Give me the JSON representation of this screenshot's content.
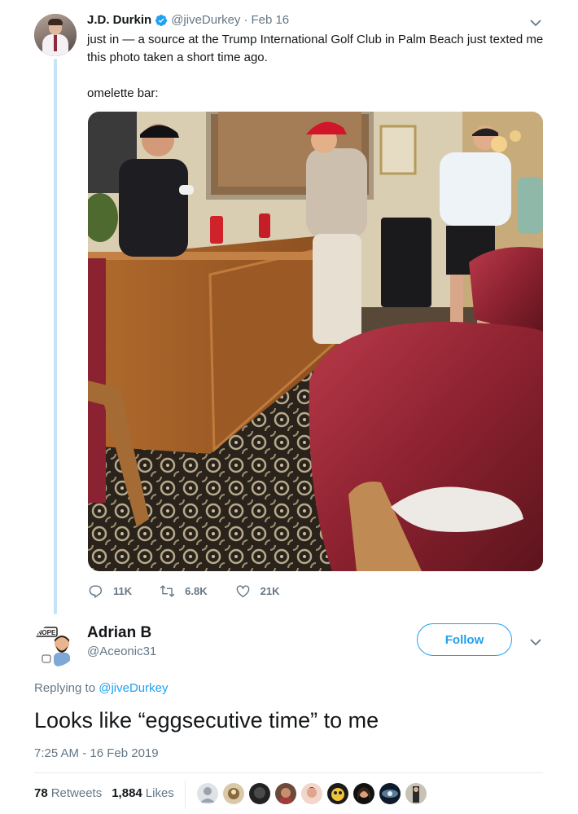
{
  "tweet1": {
    "author_name": "J.D. Durkin",
    "author_handle": "@jiveDurkey",
    "separator": "·",
    "date": "Feb 16",
    "text_line1": "just in — a source at the Trump International Golf Club in Palm Beach just texted me this photo taken a short time ago.",
    "text_line2": "omelette bar:",
    "replies": "11K",
    "retweets": "6.8K",
    "likes": "21K"
  },
  "tweet2": {
    "author_name": "Adrian B",
    "author_handle": "@Aceonic31",
    "follow_label": "Follow",
    "replying_prefix": "Replying to",
    "replying_handle": "@jiveDurkey",
    "text": "Looks like “eggsecutive time” to me",
    "timestamp": "7:25 AM - 16 Feb 2019",
    "retweet_count": "78",
    "retweet_label": "Retweets",
    "like_count": "1,884",
    "like_label": "Likes",
    "avatar_badge": "NOPE"
  },
  "colors": {
    "accent": "#1da1f2",
    "muted": "#657786",
    "thread_line": "#c4e3f7",
    "text": "#14171a"
  },
  "icons": [
    "verified-icon",
    "chevron-down-icon",
    "reply-icon",
    "retweet-icon",
    "heart-icon"
  ]
}
